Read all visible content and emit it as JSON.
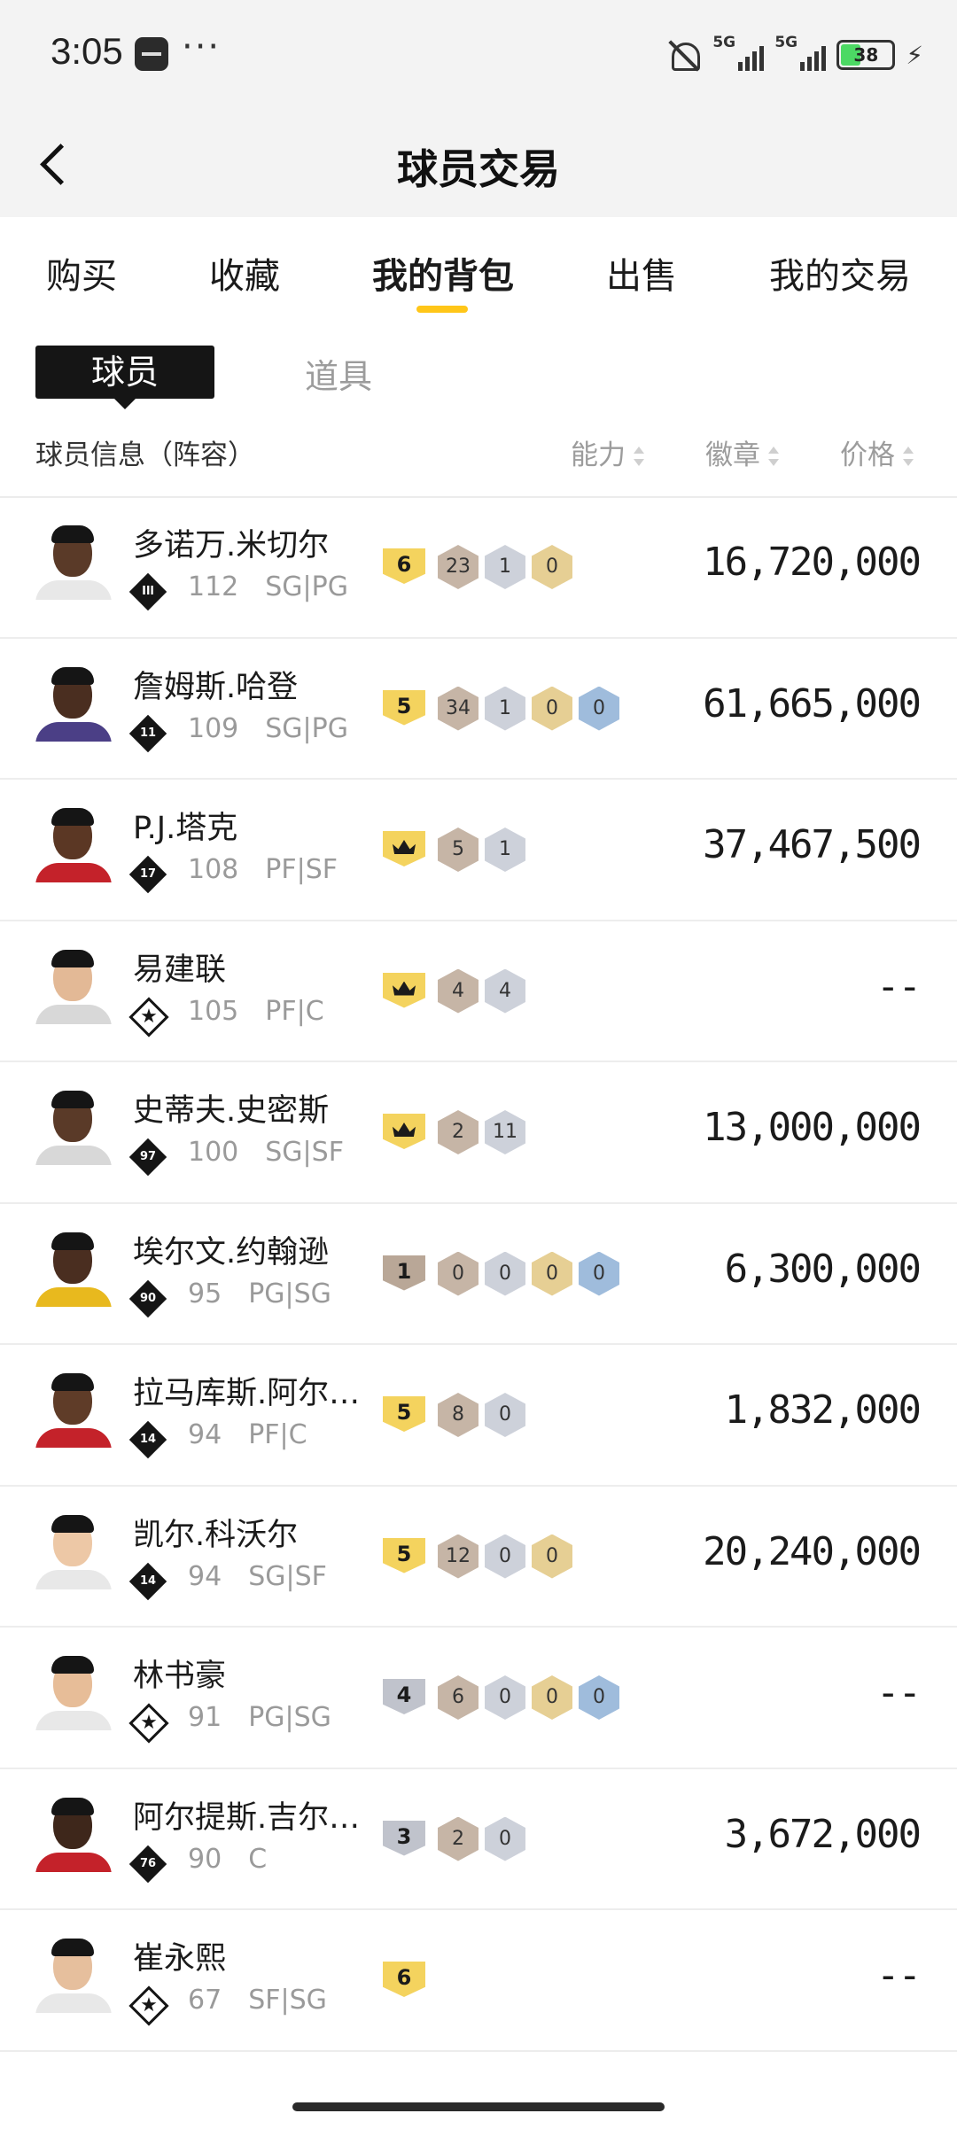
{
  "status": {
    "time": "3:05",
    "dots": "···",
    "sig1": "5G",
    "sig2": "5G",
    "battery": "38",
    "bolt": "⚡"
  },
  "header": {
    "title": "球员交易"
  },
  "tabs": [
    "购买",
    "收藏",
    "我的背包",
    "出售",
    "我的交易"
  ],
  "subtabs": {
    "player": "球员",
    "item": "道具"
  },
  "columns": {
    "info": "球员信息（阵容）",
    "ability": "能力",
    "badge": "徽章",
    "price": "价格"
  },
  "players": [
    {
      "name": "多诺万.米切尔",
      "rank": "Ill",
      "rating": "112",
      "pos": "SG|PG",
      "tier": "6",
      "badges": [
        "23",
        "1",
        "0"
      ],
      "price": "16,720,000"
    },
    {
      "name": "詹姆斯.哈登",
      "rank": "11",
      "rating": "109",
      "pos": "SG|PG",
      "tier": "5",
      "badges": [
        "34",
        "1",
        "0",
        "0"
      ],
      "price": "61,665,000"
    },
    {
      "name": "P.J.塔克",
      "rank": "17",
      "rating": "108",
      "pos": "PF|SF",
      "tier": "crown",
      "badges": [
        "5",
        "1"
      ],
      "price": "37,467,500"
    },
    {
      "name": "易建联",
      "rank": "★",
      "rating": "105",
      "pos": "PF|C",
      "tier": "crown",
      "badges": [
        "4",
        "4"
      ],
      "price": "--"
    },
    {
      "name": "史蒂夫.史密斯",
      "rank": "97",
      "rating": "100",
      "pos": "SG|SF",
      "tier": "crown",
      "badges": [
        "2",
        "11"
      ],
      "price": "13,000,000"
    },
    {
      "name": "埃尔文.约翰逊",
      "rank": "90",
      "rating": "95",
      "pos": "PG|SG",
      "tier": "1",
      "badges": [
        "0",
        "0",
        "0",
        "0"
      ],
      "price": "6,300,000"
    },
    {
      "name": "拉马库斯.阿尔…",
      "rank": "14",
      "rating": "94",
      "pos": "PF|C",
      "tier": "5",
      "badges": [
        "8",
        "0"
      ],
      "price": "1,832,000"
    },
    {
      "name": "凯尔.科沃尔",
      "rank": "14",
      "rating": "94",
      "pos": "SG|SF",
      "tier": "5",
      "badges": [
        "12",
        "0",
        "0"
      ],
      "price": "20,240,000"
    },
    {
      "name": "林书豪",
      "rank": "★",
      "rating": "91",
      "pos": "PG|SG",
      "tier": "4",
      "badges": [
        "6",
        "0",
        "0",
        "0"
      ],
      "price": "--"
    },
    {
      "name": "阿尔提斯.吉尔…",
      "rank": "76",
      "rating": "90",
      "pos": "C",
      "tier": "3",
      "badges": [
        "2",
        "0"
      ],
      "price": "3,672,000"
    },
    {
      "name": "崔永熙",
      "rank": "★",
      "rating": "67",
      "pos": "SF|SG",
      "tier": "6",
      "badges": [],
      "price": "--"
    }
  ],
  "colors": {
    "accent": "#ffc619",
    "dark": "#151515",
    "muted": "#9a9a9a"
  }
}
